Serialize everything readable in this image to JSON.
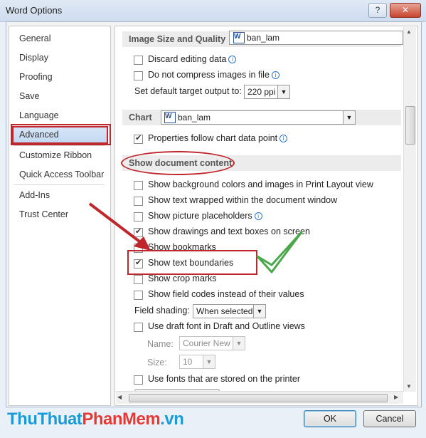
{
  "window": {
    "title": "Word Options",
    "help_glyph": "?",
    "close_glyph": "✕"
  },
  "nav": {
    "items": [
      "General",
      "Display",
      "Proofing",
      "Save",
      "Language",
      "Advanced",
      "Customize Ribbon",
      "Quick Access Toolbar",
      "Add-Ins",
      "Trust Center"
    ],
    "selected": "Advanced"
  },
  "image_section": {
    "heading": "Image Size and Quality",
    "document": "ban_lam"
  },
  "image_options": {
    "discard": "Discard editing data",
    "no_compress": "Do not compress images in file",
    "target_label": "Set default target output to:",
    "target_value": "220 ppi"
  },
  "chart_section": {
    "heading": "Chart",
    "document": "ban_lam"
  },
  "chart_options": {
    "properties_follow": "Properties follow chart data point"
  },
  "show_section": {
    "heading": "Show document content"
  },
  "show_options": [
    {
      "label": "Show background colors and images in Print Layout view",
      "checked": false
    },
    {
      "label": "Show text wrapped within the document window",
      "checked": false
    },
    {
      "label": "Show picture placeholders",
      "checked": false,
      "info": true
    },
    {
      "label": "Show drawings and text boxes on screen",
      "checked": true
    },
    {
      "label": "Show bookmarks",
      "checked": false
    },
    {
      "label": "Show text boundaries",
      "checked": true
    },
    {
      "label": "Show crop marks",
      "checked": false
    },
    {
      "label": "Show field codes instead of their values",
      "checked": false
    }
  ],
  "field_shading": {
    "label": "Field shading:",
    "value": "When selected"
  },
  "draft_font": {
    "label": "Use draft font in Draft and Outline views",
    "checked": false
  },
  "font_name": {
    "label": "Name:",
    "value": "Courier New"
  },
  "font_size": {
    "label": "Size:",
    "value": "10"
  },
  "printer_fonts": {
    "label": "Use fonts that are stored on the printer",
    "checked": false
  },
  "buttons": {
    "ok": "OK",
    "cancel": "Cancel"
  },
  "watermark": {
    "part1": "ThuThuat",
    "part2": "PhanMem",
    "part3": ".vn"
  },
  "colors": {
    "accent_red": "#c0272d",
    "selection": "#c3d8f2",
    "check_green": "#5cb85c"
  }
}
